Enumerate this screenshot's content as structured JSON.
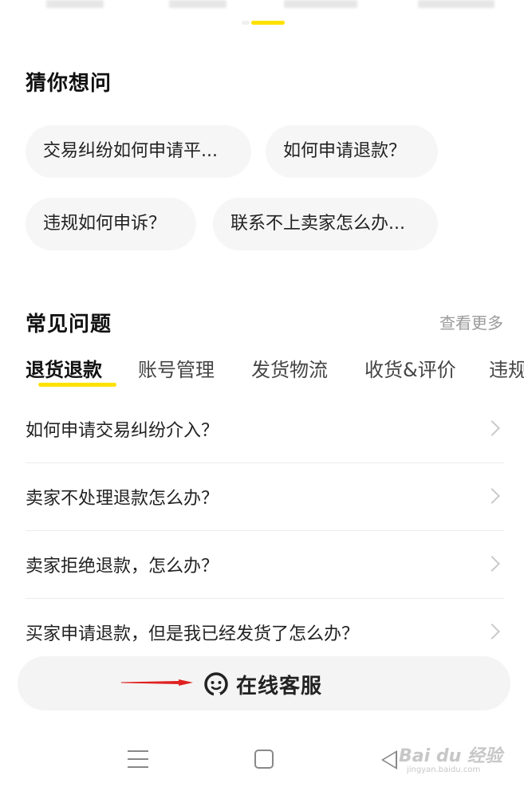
{
  "guess": {
    "title": "猜你想问",
    "chips": [
      "交易纠纷如何申请平...",
      "如何申请退款？",
      "违规如何申诉？",
      "联系不上卖家怎么办..."
    ]
  },
  "faq": {
    "title": "常见问题",
    "more_label": "查看更多",
    "tabs": [
      "退货退款",
      "账号管理",
      "发货物流",
      "收货&评价",
      "违规"
    ],
    "active_tab": "退货退款",
    "items": [
      "如何申请交易纠纷介入？",
      "卖家不处理退款怎么办？",
      "卖家拒绝退款，怎么办？",
      "买家申请退款，但是我已经发货了怎么办？"
    ]
  },
  "service": {
    "label": "在线客服",
    "icon": "customer-service-icon"
  },
  "colors": {
    "accent": "#ffe100",
    "annotation_arrow": "#e02020",
    "chip_bg": "#f6f6f6"
  }
}
